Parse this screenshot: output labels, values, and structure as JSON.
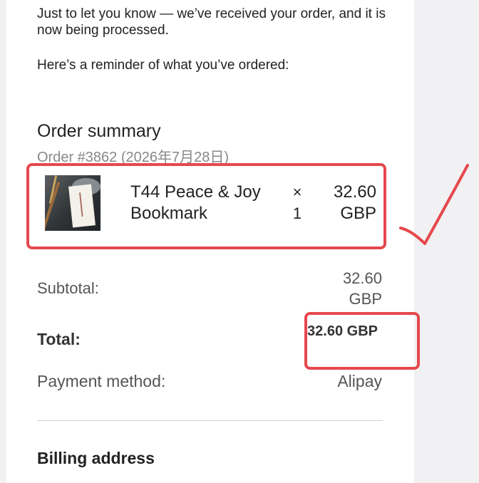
{
  "message": {
    "intro": "Just to let you know — we’ve received your order, and it is now being processed.",
    "reminder": "Here’s a reminder of what you’ve ordered:"
  },
  "order": {
    "summary_title": "Order summary",
    "order_number": "Order #3862 (2026年7月28日)",
    "items": [
      {
        "name": "T44 Peace & Joy Bookmark",
        "quantity_symbol": "×",
        "quantity": "1",
        "price": "32.60 GBP"
      }
    ]
  },
  "totals": {
    "subtotal_label": "Subtotal:",
    "subtotal_value": "32.60 GBP",
    "total_label": "Total:",
    "total_value": "32.60 GBP",
    "payment_label": "Payment method:",
    "payment_value": "Alipay"
  },
  "billing": {
    "title": "Billing address"
  },
  "annotations": {
    "highlight_color": "#e5484d",
    "checkmark_color": "#e5484d"
  }
}
